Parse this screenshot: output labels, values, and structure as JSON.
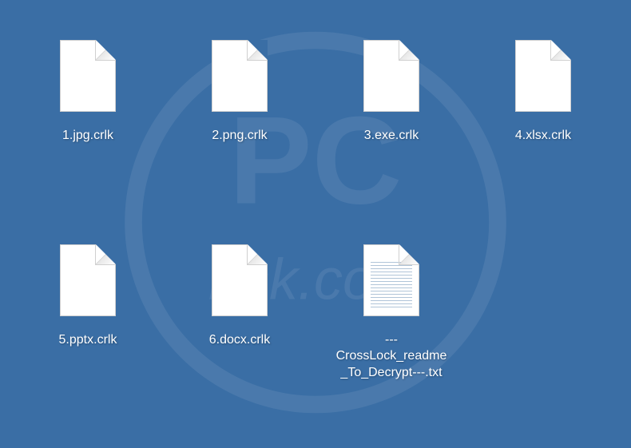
{
  "files": [
    {
      "label": "1.jpg.crlk",
      "type": "blank"
    },
    {
      "label": "2.png.crlk",
      "type": "blank"
    },
    {
      "label": "3.exe.crlk",
      "type": "blank"
    },
    {
      "label": "4.xlsx.crlk",
      "type": "blank"
    },
    {
      "label": "5.pptx.crlk",
      "type": "blank"
    },
    {
      "label": "6.docx.crlk",
      "type": "blank"
    },
    {
      "label": "---CrossLock_readme_To_Decrypt---.txt",
      "type": "text"
    }
  ],
  "watermark": {
    "text_top": "PC",
    "text_bottom": "risk.com"
  }
}
